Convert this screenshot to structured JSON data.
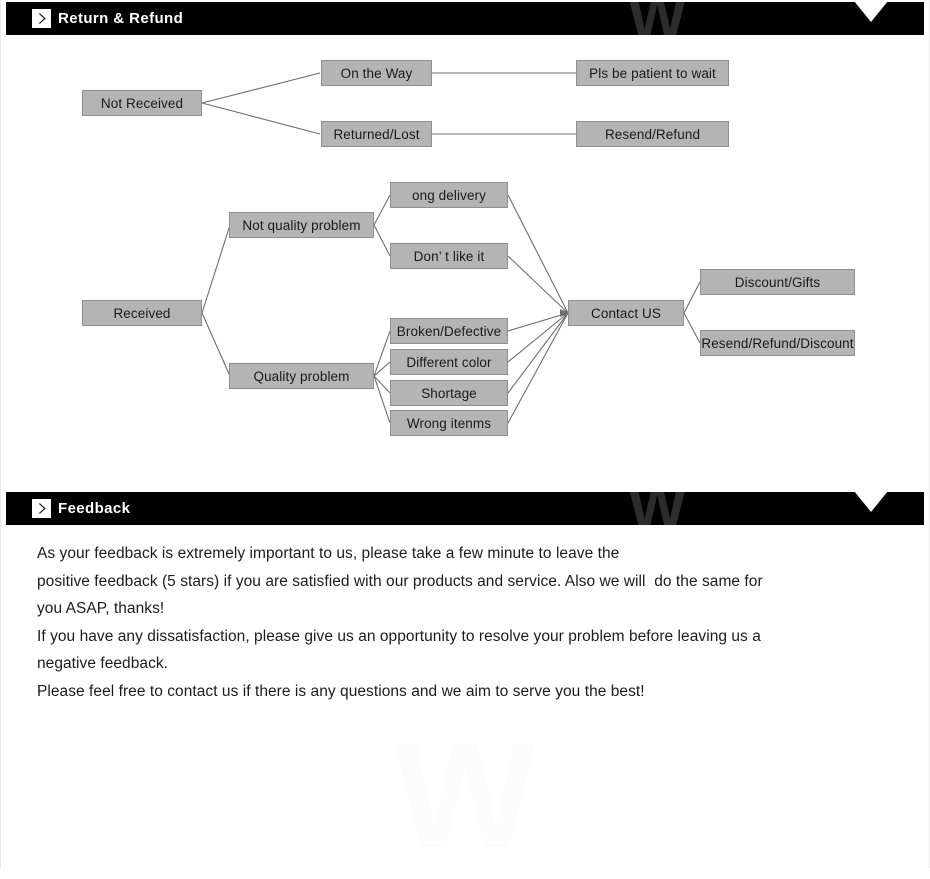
{
  "sections": [
    {
      "id": "return-refund",
      "title": "Return & Refund",
      "chevron_icon": "chevron-right-icon",
      "watermark": "W"
    },
    {
      "id": "feedback",
      "title": "Feedback",
      "chevron_icon": "chevron-right-icon",
      "watermark": "W"
    }
  ],
  "flowchart": {
    "not_received": {
      "root": "Not Received",
      "branches": [
        {
          "label": "On the Way",
          "result": "Pls be patient to wait"
        },
        {
          "label": "Returned/Lost",
          "result": "Resend/Refund"
        }
      ]
    },
    "received": {
      "root": "Received",
      "not_quality_problem": "Not quality problem",
      "not_quality_reasons": [
        "ong delivery",
        "Don’  t like it"
      ],
      "quality_problem": "Quality problem",
      "quality_reasons": [
        "Broken/Defective",
        "Different color",
        "Shortage",
        "Wrong itenms"
      ],
      "contact": "Contact US",
      "outcomes": [
        "Discount/Gifts",
        "Resend/Refund/Discount"
      ]
    }
  },
  "feedback": {
    "paragraphs": [
      "As your feedback is extremely important to us, please take a few minute to leave the",
      "positive feedback (5 stars) if you are satisfied with our products and service. Also we will  do the same for",
      "you ASAP, thanks!",
      "If you have any dissatisfaction, please give us an opportunity to resolve your problem before leaving us a",
      "negative feedback.",
      "Please feel free to contact us if there is any questions and we aim to serve you the best!"
    ]
  },
  "colors": {
    "bar_background": "#000000",
    "bar_text": "#ffffff",
    "node_fill": "#b4b4b4",
    "node_border": "#8f8f8f",
    "connector": "#6e6e6e"
  }
}
